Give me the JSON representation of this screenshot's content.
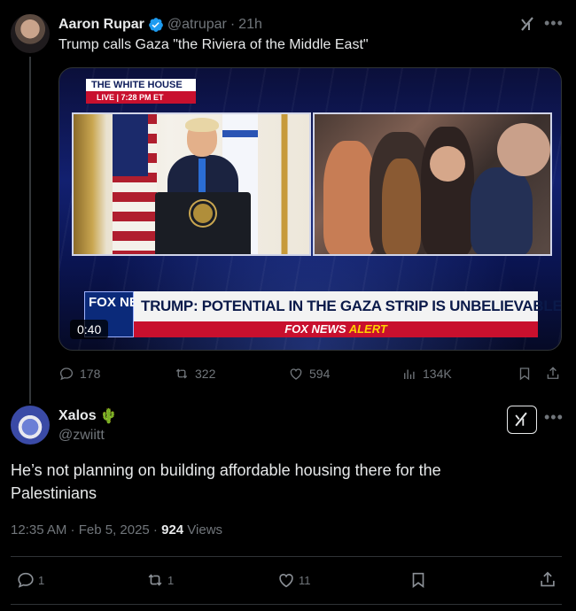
{
  "parent": {
    "author_name": "Aaron Rupar",
    "handle": "@atrupar",
    "separator": "·",
    "age": "21h",
    "text": "Trump calls Gaza \"the Riviera of the Middle East\"",
    "media": {
      "badge_title": "THE WHITE HOUSE",
      "badge_live": "LIVE | 7:28 PM ET",
      "chyron": "TRUMP: POTENTIAL IN THE GAZA STRIP IS UNBELIEVABLE",
      "alert_brand": "FOX NEWS",
      "alert_word": "ALERT",
      "logo_text": "FOX NEWS",
      "duration": "0:40"
    },
    "actions": {
      "replies": "178",
      "reposts": "322",
      "likes": "594",
      "views": "134K"
    }
  },
  "reply": {
    "author_name": "Xalos",
    "name_emoji": "🌵",
    "handle": "@zwiitt",
    "text": "He’s not planning on building affordable housing there for the Palestinians",
    "time": "12:35 AM · Feb 5, 2025 · ",
    "views_count": "924",
    "views_label": " Views",
    "actions": {
      "replies": "1",
      "reposts": "1",
      "likes": "11"
    }
  },
  "colors": {
    "background": "#000000",
    "text": "#e7e9ea",
    "muted": "#71767b",
    "verified": "#1d9bf0",
    "divider": "#2f3336"
  }
}
